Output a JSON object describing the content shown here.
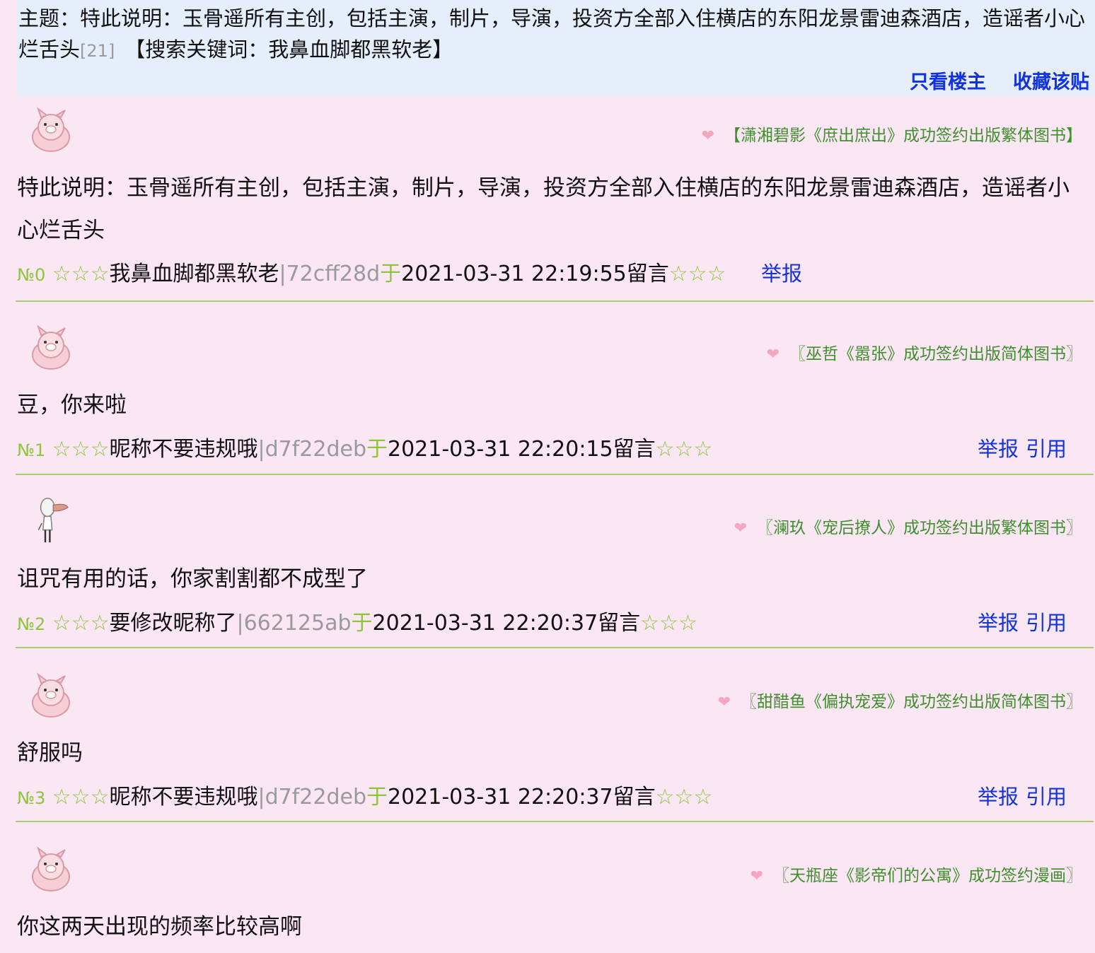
{
  "thread": {
    "subject_label": "主题：",
    "subject_text": "特此说明：玉骨遥所有主创，包括主演，制片，导演，投资方全部入住横店的东阳龙景雷迪森酒店，造谣者小心烂舌头",
    "reply_count": "[21]",
    "keyword_text": "【搜索关键词：我鼻血脚都黑软老】",
    "only_op_label": "只看楼主",
    "favorite_label": "收藏该贴"
  },
  "posts": [
    {
      "signature": "【潇湘碧影《庶出庶出》成功签约出版繁体图书】",
      "content": "特此说明：玉骨遥所有主创，包括主演，制片，导演，投资方全部入住横店的东阳龙景雷迪森酒店，造谣者小心烂舌头",
      "number": "№0",
      "stars_left": "☆☆☆",
      "nickname": "我鼻血脚都黑软老",
      "hash": "|72cff28d",
      "yu": "于",
      "time": "2021-03-31 22:19:55留言",
      "stars_right": "☆☆☆",
      "report_label": "举报"
    },
    {
      "signature": "〖巫哲《嚣张》成功签约出版简体图书〗",
      "content": "豆，你来啦",
      "number": "№1",
      "stars_left": "☆☆☆",
      "nickname": "昵称不要违规哦",
      "hash": "|d7f22deb",
      "yu": "于",
      "time": "2021-03-31 22:20:15留言",
      "stars_right": "☆☆☆",
      "report_label": "举报",
      "quote_label": "引用"
    },
    {
      "signature": "〖澜玖《宠后撩人》成功签约出版繁体图书〗",
      "content": "诅咒有用的话，你家割割都不成型了",
      "number": "№2",
      "stars_left": "☆☆☆",
      "nickname": "要修改昵称了",
      "hash": "|662125ab",
      "yu": "于",
      "time": "2021-03-31 22:20:37留言",
      "stars_right": "☆☆☆",
      "report_label": "举报",
      "quote_label": "引用"
    },
    {
      "signature": "〖甜醋鱼《偏执宠爱》成功签约出版简体图书〗",
      "content": "舒服吗",
      "number": "№3",
      "stars_left": "☆☆☆",
      "nickname": "昵称不要违规哦",
      "hash": "|d7f22deb",
      "yu": "于",
      "time": "2021-03-31 22:20:37留言",
      "stars_right": "☆☆☆",
      "report_label": "举报",
      "quote_label": "引用"
    },
    {
      "signature": "〖天瓶座《影帝们的公寓》成功签约漫画〗",
      "content": "你这两天出现的频率比较高啊"
    }
  ],
  "heart_glyph": "❤",
  "colors": {
    "page_bg": "#fbe6f3",
    "header_bg": "#e6eefb",
    "link": "#1133dd",
    "green": "#8cc63f",
    "signature_green": "#3f8f2f",
    "hash_gray": "#9a9a9a",
    "divider": "#a8cf6a"
  }
}
